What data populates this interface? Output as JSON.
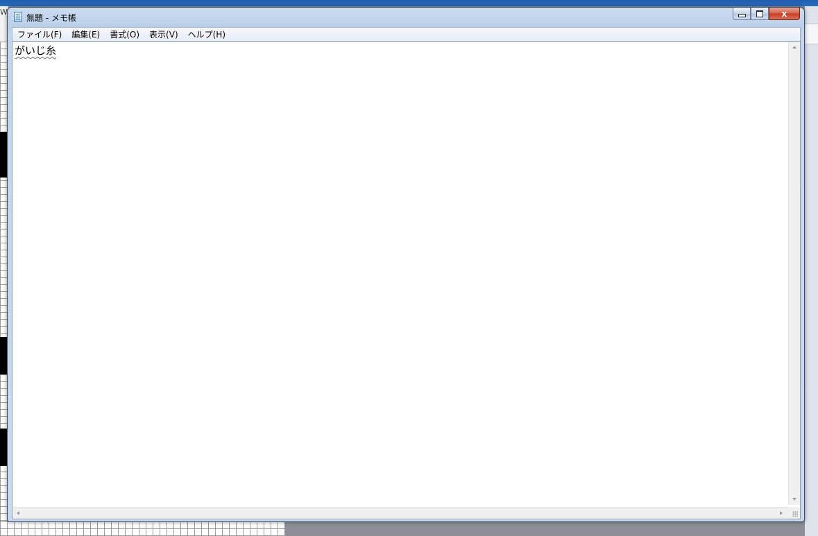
{
  "background": {
    "partial_text": "W"
  },
  "window": {
    "title": "無題 - メモ帳",
    "app_icon": "notepad-icon",
    "controls": {
      "minimize": "minimize-icon",
      "maximize": "maximize-icon",
      "close_label": "x"
    }
  },
  "menubar": {
    "items": [
      {
        "label": "ファイル(F)"
      },
      {
        "label": "編集(E)"
      },
      {
        "label": "書式(O)"
      },
      {
        "label": "表示(V)"
      },
      {
        "label": "ヘルプ(H)"
      }
    ]
  },
  "editor": {
    "text": "がいじ糸"
  },
  "colors": {
    "title_bar": "#c3d5ec",
    "close_button": "#c43a21",
    "editor_background": "#ffffff"
  }
}
